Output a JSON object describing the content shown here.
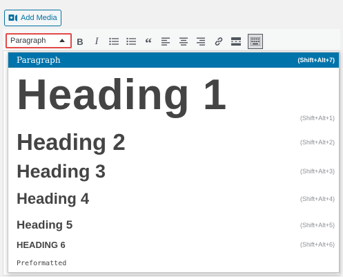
{
  "media": {
    "add_media_label": "Add Media"
  },
  "toolbar": {
    "format_value": "Paragraph",
    "buttons": [
      {
        "icon": "bold-icon",
        "glyph": "B"
      },
      {
        "icon": "italic-icon",
        "glyph": "I"
      },
      {
        "icon": "bulleted-list-icon"
      },
      {
        "icon": "numbered-list-icon"
      },
      {
        "icon": "blockquote-icon",
        "glyph": "“"
      },
      {
        "icon": "align-left-icon"
      },
      {
        "icon": "align-center-icon"
      },
      {
        "icon": "align-right-icon"
      },
      {
        "icon": "link-icon"
      },
      {
        "icon": "read-more-icon"
      },
      {
        "icon": "toolbar-toggle-icon"
      }
    ]
  },
  "dropdown": {
    "items": [
      {
        "label": "Paragraph",
        "shortcut": "(Shift+Alt+7)",
        "selected": true
      },
      {
        "label": "Heading 1",
        "shortcut": "(Shift+Alt+1)"
      },
      {
        "label": "Heading 2",
        "shortcut": "(Shift+Alt+2)"
      },
      {
        "label": "Heading 3",
        "shortcut": "(Shift+Alt+3)"
      },
      {
        "label": "Heading 4",
        "shortcut": "(Shift+Alt+4)"
      },
      {
        "label": "Heading 5",
        "shortcut": "(Shift+Alt+5)"
      },
      {
        "label": "HEADING 6",
        "shortcut": "(Shift+Alt+6)"
      },
      {
        "label": "Preformatted",
        "shortcut": ""
      }
    ]
  },
  "colors": {
    "accent": "#0073aa",
    "highlight_border": "#e34848",
    "button_text": "#0071a1"
  }
}
